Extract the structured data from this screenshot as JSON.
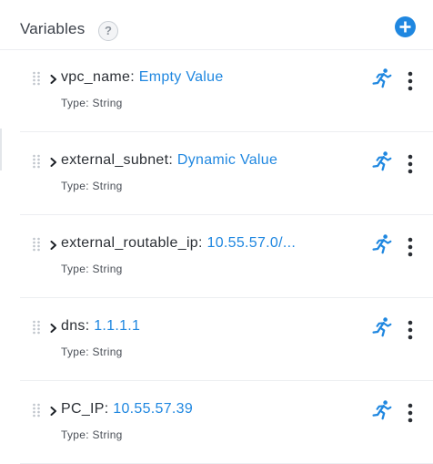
{
  "header": {
    "title": "Variables",
    "help_glyph": "?"
  },
  "colors": {
    "accent": "#1f87e0",
    "text": "#2b2f35",
    "divider": "#eceef1"
  },
  "icons": {
    "header": [
      "help-icon",
      "add-icon"
    ],
    "row": [
      "drag-handle-icon",
      "chevron-right-icon",
      "run-icon",
      "more-vertical-icon"
    ]
  },
  "variables": [
    {
      "name": "vpc_name",
      "value": "Empty Value",
      "type_label": "Type:",
      "type": "String"
    },
    {
      "name": "external_subnet",
      "value": "Dynamic Value",
      "type_label": "Type:",
      "type": "String"
    },
    {
      "name": "external_routable_ip",
      "value": "10.55.57.0/...",
      "type_label": "Type:",
      "type": "String"
    },
    {
      "name": "dns",
      "value": "1.1.1.1",
      "type_label": "Type:",
      "type": "String"
    },
    {
      "name": "PC_IP",
      "value": "10.55.57.39",
      "type_label": "Type:",
      "type": "String"
    }
  ]
}
